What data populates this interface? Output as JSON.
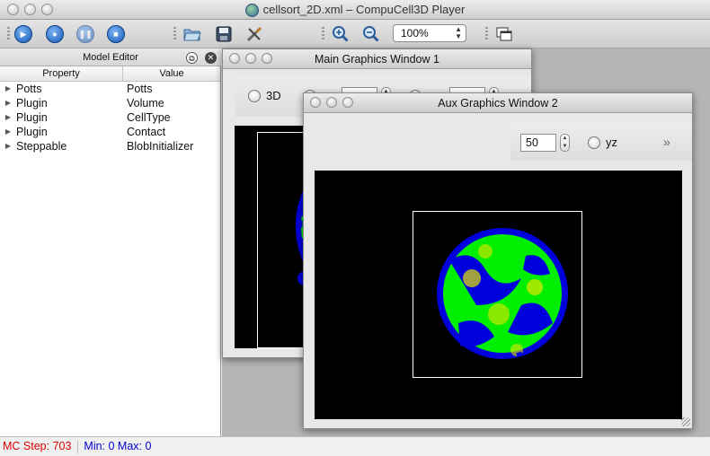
{
  "window": {
    "title": "cellsort_2D.xml – CompuCell3D Player"
  },
  "toolbar": {
    "zoom_value": "100%",
    "buttons": [
      {
        "name": "run",
        "icon": "play-icon"
      },
      {
        "name": "step",
        "icon": "step-icon"
      },
      {
        "name": "pause",
        "icon": "pause-icon"
      },
      {
        "name": "stop",
        "icon": "stop-icon"
      },
      {
        "name": "open",
        "icon": "folder-open-icon"
      },
      {
        "name": "save",
        "icon": "save-icon"
      },
      {
        "name": "tools",
        "icon": "tools-icon"
      },
      {
        "name": "zoom-in",
        "icon": "zoom-in-icon"
      },
      {
        "name": "zoom-out",
        "icon": "zoom-out-icon"
      },
      {
        "name": "new-window",
        "icon": "new-window-icon"
      }
    ]
  },
  "model_editor": {
    "title": "Model Editor",
    "columns": [
      "Property",
      "Value"
    ],
    "rows": [
      {
        "property": "Potts",
        "value": "Potts"
      },
      {
        "property": "Plugin",
        "value": "Volume"
      },
      {
        "property": "Plugin",
        "value": "CellType"
      },
      {
        "property": "Plugin",
        "value": "Contact"
      },
      {
        "property": "Steppable",
        "value": "BlobInitializer"
      }
    ]
  },
  "main_window": {
    "title": "Main Graphics Window 1",
    "radio_3d": "3D"
  },
  "aux_window": {
    "title": "Aux Graphics Window 2",
    "slice_value": "50",
    "radio_yz": "yz",
    "overflow": "»"
  },
  "status": {
    "mc_step": "MC Step: 703",
    "range": "Min: 0 Max: 0"
  },
  "colors": {
    "cell_green": "#00ee00",
    "cell_blue": "#0000dd",
    "cell_yellow": "#e6e600",
    "status_red": "#dd0000",
    "status_blue": "#0000cc"
  }
}
